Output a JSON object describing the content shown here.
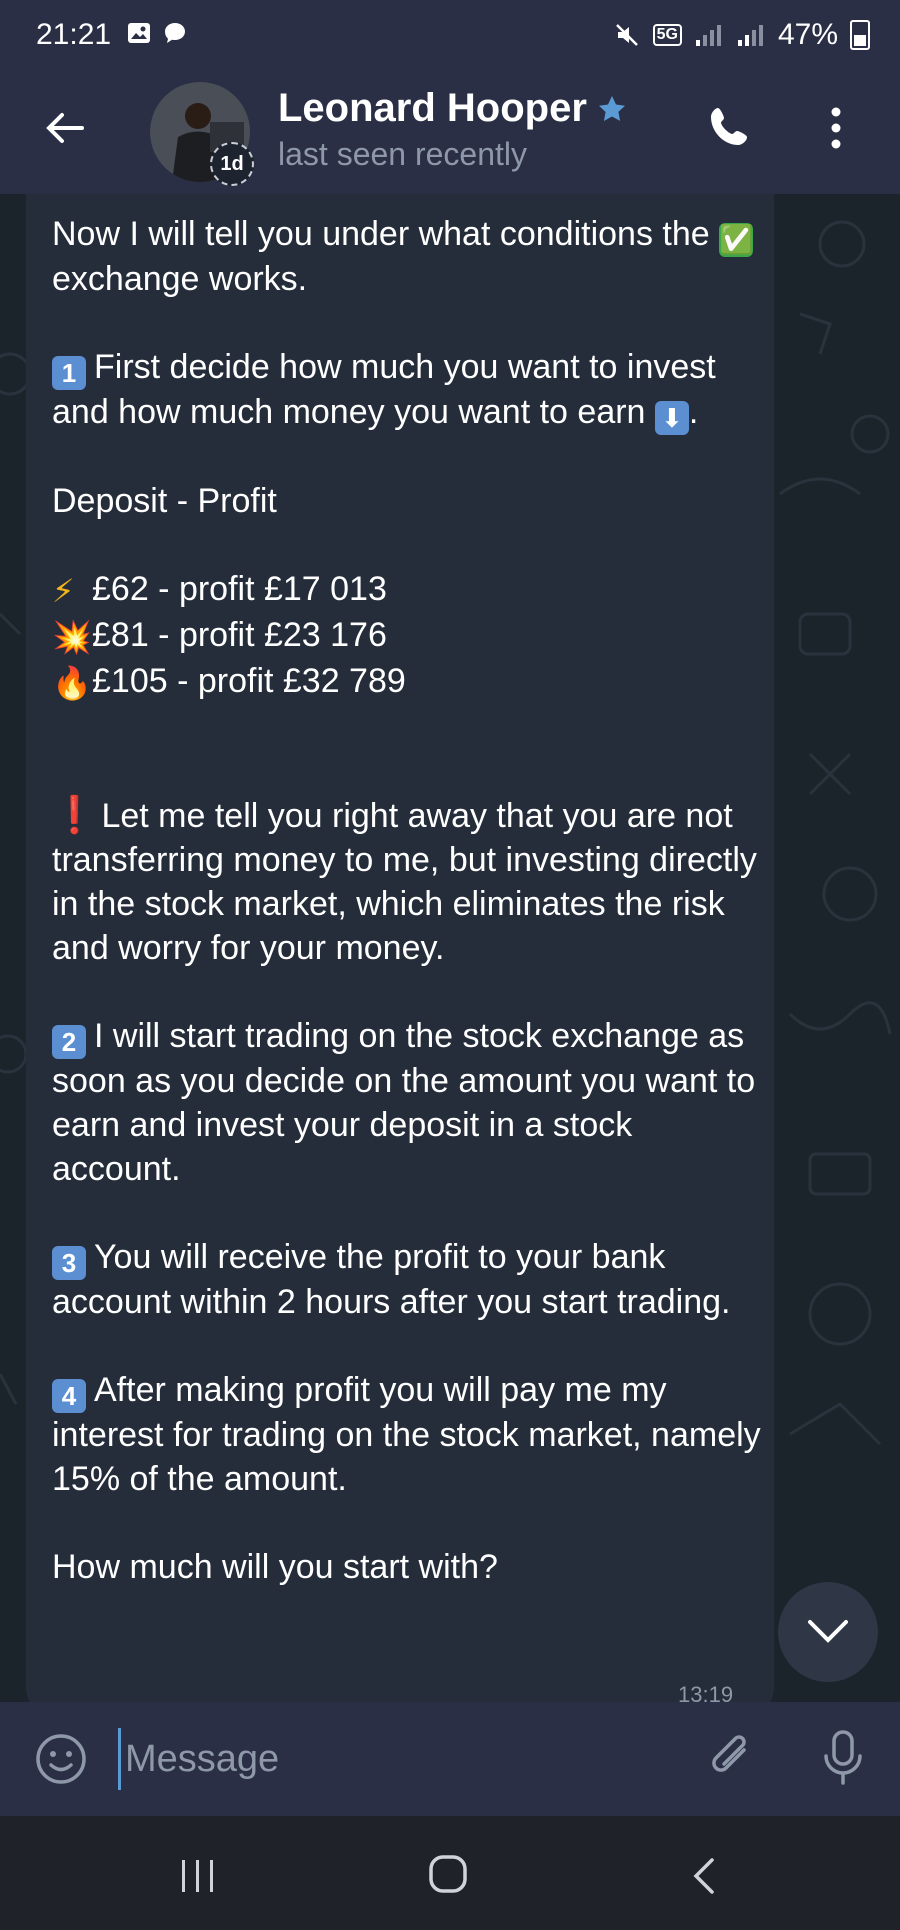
{
  "status_bar": {
    "time": "21:21",
    "battery": "47%",
    "network": "5G"
  },
  "header": {
    "contact_name": "Leonard Hooper",
    "contact_status": "last seen recently",
    "story_badge": "1d",
    "icons": [
      "back-arrow-icon",
      "phone-icon",
      "more-vert-icon",
      "star-icon"
    ]
  },
  "message": {
    "intro": "Now I will tell you under what conditions the",
    "intro_emoji": "✅",
    "intro_end": "exchange works.",
    "step1_num": "1",
    "step1_text": "First decide how much you want to invest and how much money you want to earn",
    "step1_emoji": "⬇",
    "step1_end": ".",
    "deposit_heading": "Deposit - Profit",
    "tiers": [
      {
        "emoji": "⚡",
        "text": "£62 - profit £17 013"
      },
      {
        "emoji": "💥",
        "text": "£81 - profit £23 176"
      },
      {
        "emoji": "🔥",
        "text": "£105 - profit £32 789"
      }
    ],
    "warning_emoji": "❗",
    "warning_text": "Let me tell you right away that you are not transferring money to me, but investing directly in the stock market, which eliminates the risk and worry for your money.",
    "step2_num": "2",
    "step2_text": "I will start trading on the stock exchange as soon as you decide on the amount you want to earn and invest your deposit in a stock account.",
    "step3_num": "3",
    "step3_text": "You will receive the profit to your bank account within 2 hours after you start trading.",
    "step4_num": "4",
    "step4_text": "After making profit you will pay me my interest for trading on the stock market, namely 15% of the amount.",
    "closing": "How much will you start with?",
    "time": "13:19"
  },
  "composer": {
    "placeholder": "Message",
    "icons": [
      "emoji-icon",
      "paperclip-icon",
      "microphone-icon"
    ]
  },
  "colors": {
    "header_bg": "#2a2f45",
    "bubble_bg": "#252d3a",
    "chat_bg": "#1b232b",
    "accent": "#5b9bd5"
  }
}
